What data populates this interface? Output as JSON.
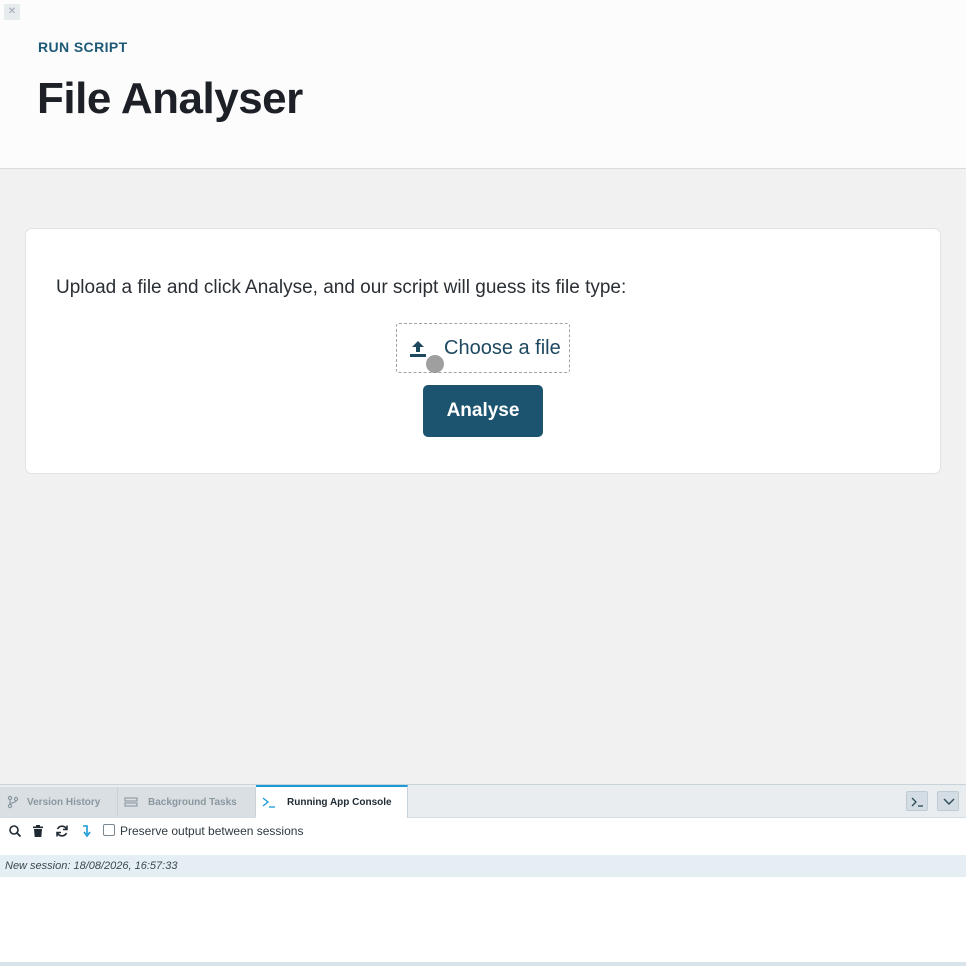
{
  "header": {
    "kicker": "RUN SCRIPT",
    "title": "File Analyser"
  },
  "card": {
    "intro": "Upload a file and click Analyse, and our script will guess its file type:",
    "file_button_label": "Choose a file",
    "analyse_label": "Analyse"
  },
  "panel": {
    "tabs": [
      {
        "label": "Version History",
        "icon": "branch-icon",
        "active": false
      },
      {
        "label": "Background Tasks",
        "icon": "tasks-icon",
        "active": false
      },
      {
        "label": "Running App Console",
        "icon": "terminal-icon",
        "active": true
      }
    ],
    "toolbar": {
      "preserve_label": "Preserve output between sessions",
      "preserve_checked": false,
      "icons": [
        "search-icon",
        "trash-icon",
        "refresh-icon",
        "scroll-down-icon"
      ]
    },
    "session_text": "New session: 18/08/2026, 16:57:33"
  },
  "colors": {
    "primary": "#1c5470",
    "kicker": "#1e5a78",
    "active_tab_accent": "#1a9ad6"
  }
}
